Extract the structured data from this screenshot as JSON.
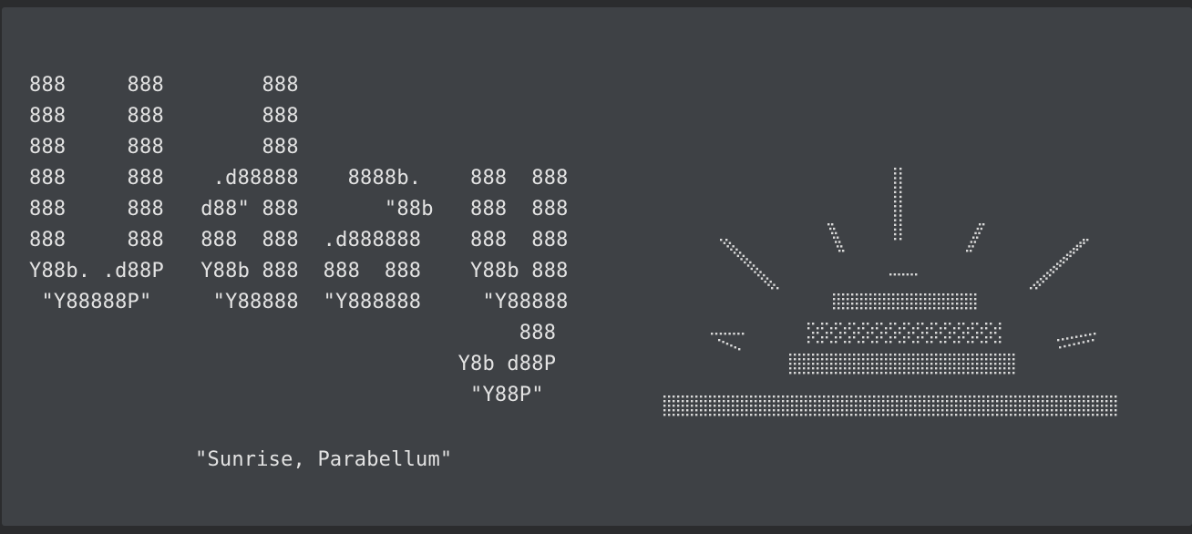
{
  "terminal": {
    "banner_ascii_art": "888     888        888\n888     888        888\n888     888        888\n888     888    .d88888    8888b.    888  888\n888     888   d88\" 888       \"88b   888  888\n888     888   888  888  .d888888    888  888\nY88b. .d88P   Y88b 888  888  888    Y88b 888\n \"Y88888P\"     \"Y88888  \"Y888888     \"Y88888\n                                        888\n                                   Y8b d88P\n                                    \"Y88P\"",
    "caption": "\"Sunrise, Parabellum\"",
    "art_icon": "braille-sunrise-icon"
  }
}
